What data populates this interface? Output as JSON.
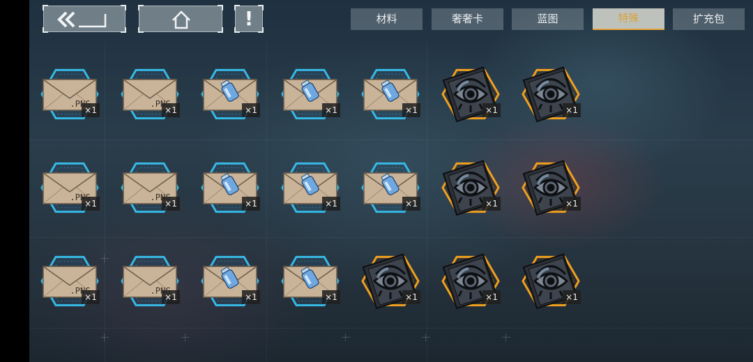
{
  "nav": {
    "back_icon": "double-chevron-left-icon",
    "home_icon": "house-icon",
    "alert_label": "!"
  },
  "tabs": [
    {
      "label": "材料",
      "active": false
    },
    {
      "label": "奢奢卡",
      "active": false
    },
    {
      "label": "蓝图",
      "active": false
    },
    {
      "label": "特殊",
      "active": true
    },
    {
      "label": "扩充包",
      "active": false
    }
  ],
  "colors": {
    "accent_gold": "#e7a838",
    "frame_blue": "#37b9e6",
    "frame_gold": "#f0a020",
    "envelope": "#c9b49a"
  },
  "envelope_png_label": ".PNG",
  "items": [
    {
      "type": "envelope-png",
      "qty": "×1"
    },
    {
      "type": "envelope-png",
      "qty": "×1"
    },
    {
      "type": "envelope-bottle",
      "qty": "×1"
    },
    {
      "type": "envelope-bottle",
      "qty": "×1"
    },
    {
      "type": "envelope-bottle",
      "qty": "×1"
    },
    {
      "type": "eye-card",
      "qty": "×1"
    },
    {
      "type": "eye-card",
      "qty": "×1"
    },
    {
      "type": "envelope-png",
      "qty": "×1"
    },
    {
      "type": "envelope-png",
      "qty": "×1"
    },
    {
      "type": "envelope-bottle",
      "qty": "×1"
    },
    {
      "type": "envelope-bottle",
      "qty": "×1"
    },
    {
      "type": "envelope-bottle",
      "qty": "×1"
    },
    {
      "type": "eye-card",
      "qty": "×1"
    },
    {
      "type": "eye-card",
      "qty": "×1"
    },
    {
      "type": "envelope-png",
      "qty": "×1"
    },
    {
      "type": "envelope-png",
      "qty": "×1"
    },
    {
      "type": "envelope-bottle",
      "qty": "×1"
    },
    {
      "type": "envelope-bottle",
      "qty": "×1"
    },
    {
      "type": "eye-card",
      "qty": "×1"
    },
    {
      "type": "eye-card",
      "qty": "×1"
    },
    {
      "type": "eye-card",
      "qty": "×1"
    }
  ]
}
